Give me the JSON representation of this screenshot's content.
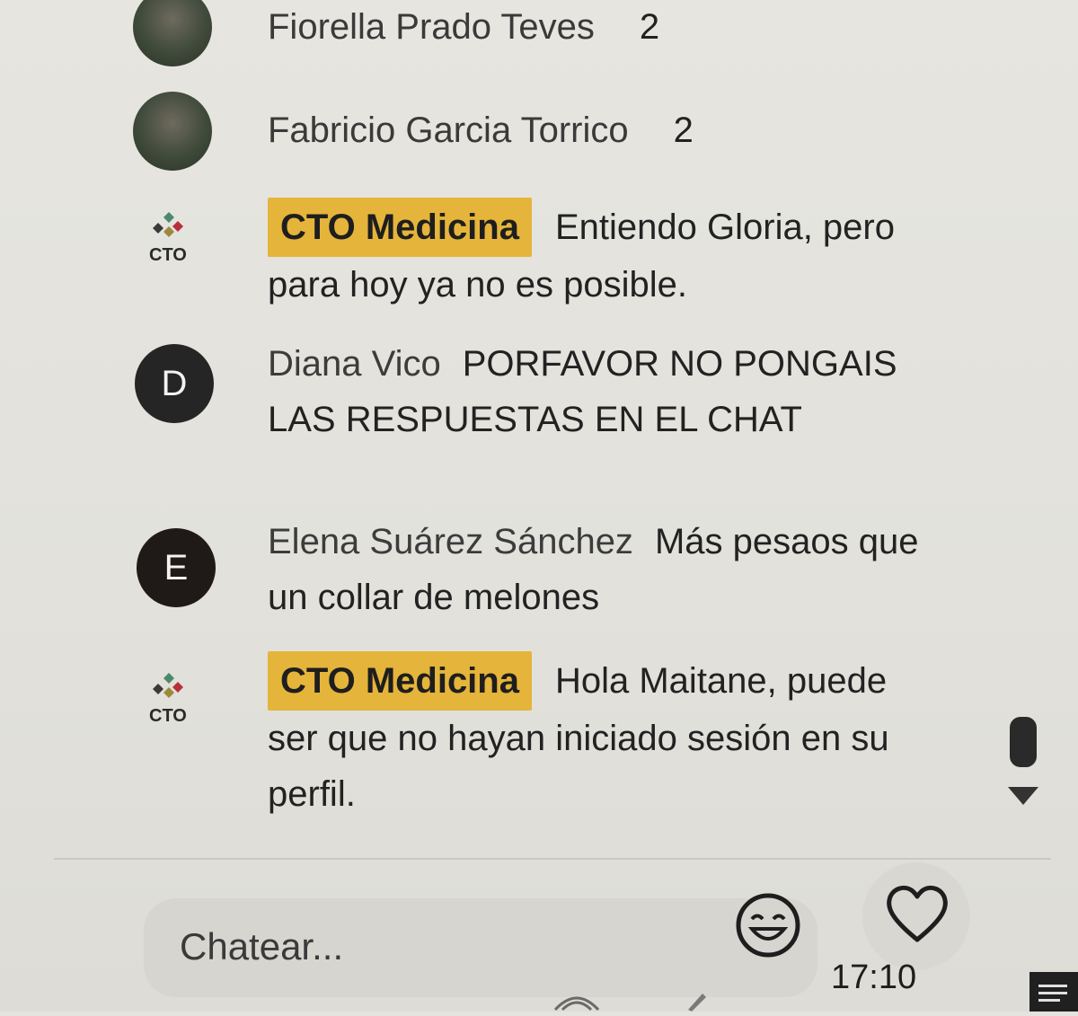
{
  "messages": [
    {
      "author": "Fiorella Prado Teves",
      "count": "2"
    },
    {
      "author": "Fabricio Garcia Torrico",
      "count": "2"
    },
    {
      "author": "CTO Medicina",
      "text": "Entiendo Gloria, pero para hoy ya no es posible.",
      "logo_text": "CTO"
    },
    {
      "author": "Diana Vico",
      "text": "PORFAVOR NO PONGAIS LAS RESPUESTAS EN EL CHAT",
      "avatar_letter": "D"
    },
    {
      "author": "Elena Suárez Sánchez",
      "text": "Más pesaos que un collar de melones",
      "avatar_letter": "E"
    },
    {
      "author": "CTO Medicina",
      "text": "Hola Maitane, puede ser que no hayan iniciado sesión en su perfil.",
      "logo_text": "CTO"
    }
  ],
  "input": {
    "placeholder": "Chatear..."
  },
  "icons": {
    "emoji": "smiling-face-icon",
    "heart": "heart-icon",
    "scroll_down": "triangle-down-icon"
  },
  "taskbar": {
    "time": "17:10"
  },
  "colors": {
    "badge": "#e5b43a",
    "background": "#e4e3dd",
    "avatar_letter_bg": "#252525"
  }
}
